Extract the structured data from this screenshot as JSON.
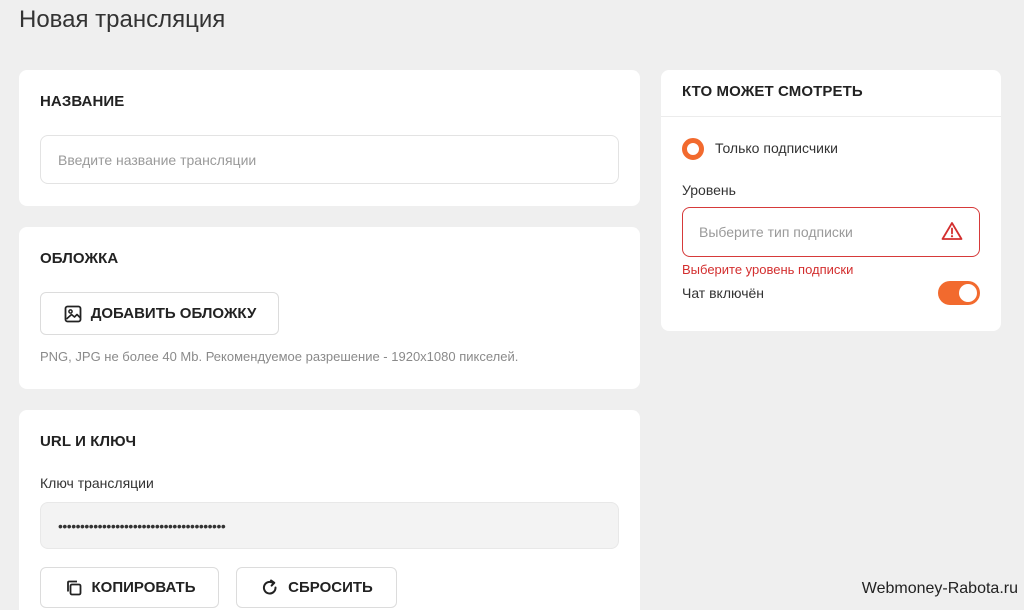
{
  "page": {
    "title": "Новая трансляция"
  },
  "name_section": {
    "heading": "НАЗВАНИЕ",
    "input_placeholder": "Введите название трансляции",
    "input_value": ""
  },
  "cover_section": {
    "heading": "ОБЛОЖКА",
    "add_button_label": "ДОБАВИТЬ ОБЛОЖКУ",
    "add_button_icon": "image-icon",
    "hint": "PNG, JPG не более 40 Mb. Рекомендуемое разрешение - 1920x1080 пикселей."
  },
  "url_section": {
    "heading": "URL И КЛЮЧ",
    "key_label": "Ключ трансляции",
    "key_value": "••••••••••••••••••••••••••••••••••••••",
    "copy_button_label": "КОПИРОВАТЬ",
    "copy_button_icon": "copy-icon",
    "reset_button_label": "СБРОСИТЬ",
    "reset_button_icon": "refresh-icon"
  },
  "audience_section": {
    "heading": "КТО МОЖЕТ СМОТРЕТЬ",
    "radio_label": "Только подписчики",
    "radio_checked": true,
    "level_label": "Уровень",
    "level_placeholder": "Выберите тип подписки",
    "level_error": "Выберите уровень подписки",
    "error_icon": "warning-icon",
    "chat_label": "Чат включён",
    "chat_enabled": true
  },
  "watermark": "Webmoney-Rabota.ru",
  "colors": {
    "accent": "#f26a2e",
    "error": "#d32f2f",
    "background": "#efefef",
    "card": "#ffffff"
  }
}
